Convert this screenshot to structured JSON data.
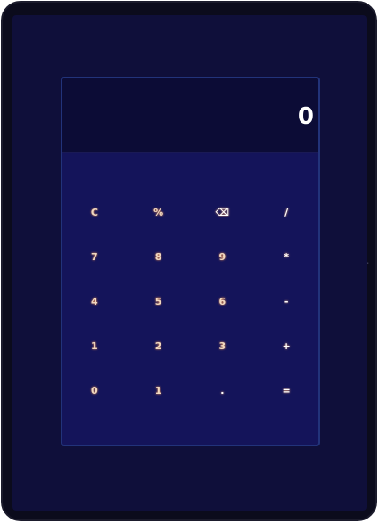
{
  "calculator": {
    "display_value": "0",
    "keys": [
      {
        "label": "C"
      },
      {
        "label": "%"
      },
      {
        "label": "⌫"
      },
      {
        "label": "/"
      },
      {
        "label": "7"
      },
      {
        "label": "8"
      },
      {
        "label": "9"
      },
      {
        "label": "*"
      },
      {
        "label": "4"
      },
      {
        "label": "5"
      },
      {
        "label": "6"
      },
      {
        "label": "-"
      },
      {
        "label": "1"
      },
      {
        "label": "2"
      },
      {
        "label": "3"
      },
      {
        "label": "+"
      },
      {
        "label": "0"
      },
      {
        "label": "1"
      },
      {
        "label": "."
      },
      {
        "label": "="
      }
    ]
  },
  "colors": {
    "bezel": "#0b0b1c",
    "screen": "#0f0f3a",
    "calc_body": "#14145a",
    "display_bg": "#0c0c36",
    "key_text": "#f0d8c0"
  }
}
